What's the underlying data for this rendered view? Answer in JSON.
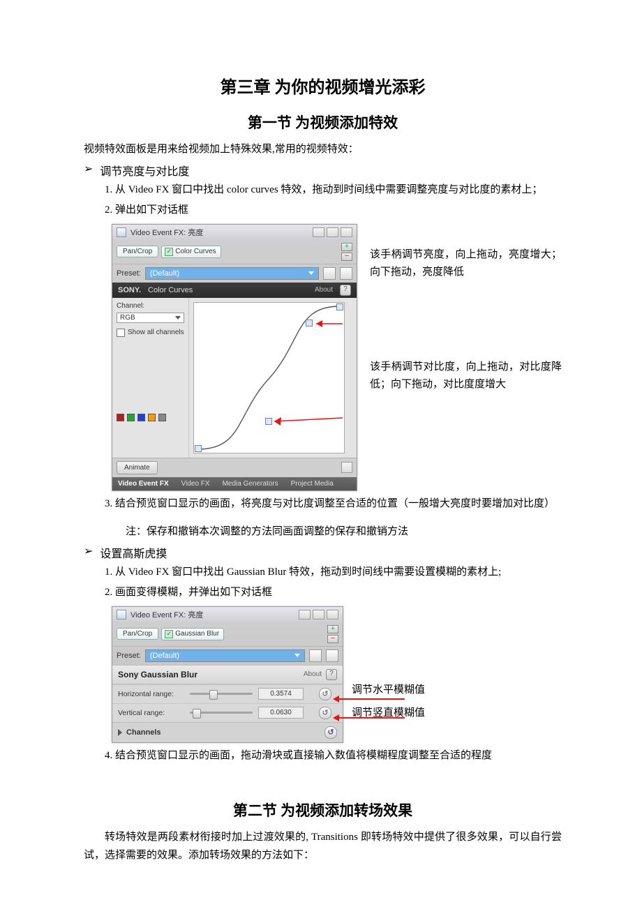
{
  "headings": {
    "chapter": "第三章 为你的视频增光添彩",
    "section1": "第一节 为视频添加特效",
    "section2": "第二节 为视频添加转场效果"
  },
  "section1": {
    "intro": "视频特效面板是用来给视频加上特殊效果,常用的视频特效：",
    "bulletA": "调节亮度与对比度",
    "a1": "1. 从 Video FX 窗口中找出 color curves 特效，拖动到时间线中需要调整亮度与对比度的素材上；",
    "a2": "2. 弹出如下对话框",
    "a3": "3. 结合预览窗口显示的画面，将亮度与对比度调整至合适的位置（一般增大亮度时要增加对比度）",
    "a3note": "注：保存和撤销本次调整的方法同画面调整的保存和撤销方法",
    "bulletB": "设置高斯虎摸",
    "b1": "1.  从 Video FX 窗口中找出 Gaussian Blur 特效，拖动到时间线中需要设置模糊的素材上;",
    "b2": "2.  画面变得模糊，并弹出如下对话框",
    "b4": "4. 结合预览窗口显示的画面，拖动滑块或直接输入数值将模糊程度调整至合适的程度"
  },
  "section2": {
    "intro": "转场特效是两段素材衔接时加上过渡效果的, Transitions 即转场特效中提供了很多效果，可以自行尝试，选择需要的效果。添加转场效果的方法如下："
  },
  "fig1": {
    "winTitle": "Video Event FX:  亮度",
    "chainA": "Pan/Crop",
    "chainB": "Color Curves",
    "presetLabel": "Preset:",
    "presetValue": "(Default)",
    "sony": "SONY.",
    "fxName": "Color Curves",
    "about": "About",
    "channelLabel": "Channel:",
    "channelValue": "RGB",
    "showAll": "Show all channels",
    "swatches": [
      "#a22",
      "#2a3",
      "#24c",
      "#ff9b00",
      "#888"
    ],
    "animate": "Animate",
    "tabs": {
      "a": "Video Event FX",
      "b": "Video FX",
      "c": "Media Generators",
      "d": "Project Media"
    },
    "anno1": "该手柄调节亮度，向上拖动，亮度增大；向下拖动，亮度降低",
    "anno2": "该手柄调节对比度，向上拖动，对比度降低；向下拖动，对比度度增大"
  },
  "fig2": {
    "winTitle": "Video Event FX:  亮度",
    "chainA": "Pan/Crop",
    "chainB": "Gaussian Blur",
    "presetLabel": "Preset:",
    "presetValue": "(Default)",
    "headTitle": "Sony Gaussian Blur",
    "about": "About",
    "hLabel": "Horizontal range:",
    "hVal": "0.3574",
    "vLabel": "Vertical range:",
    "vVal": "0.0630",
    "channels": "Channels",
    "anno1": "调节水平模糊值",
    "anno2": "调节竖直模糊值"
  },
  "glyphs": {
    "bullet": "➢",
    "check": "✓",
    "help": "?",
    "reset": "↺"
  }
}
